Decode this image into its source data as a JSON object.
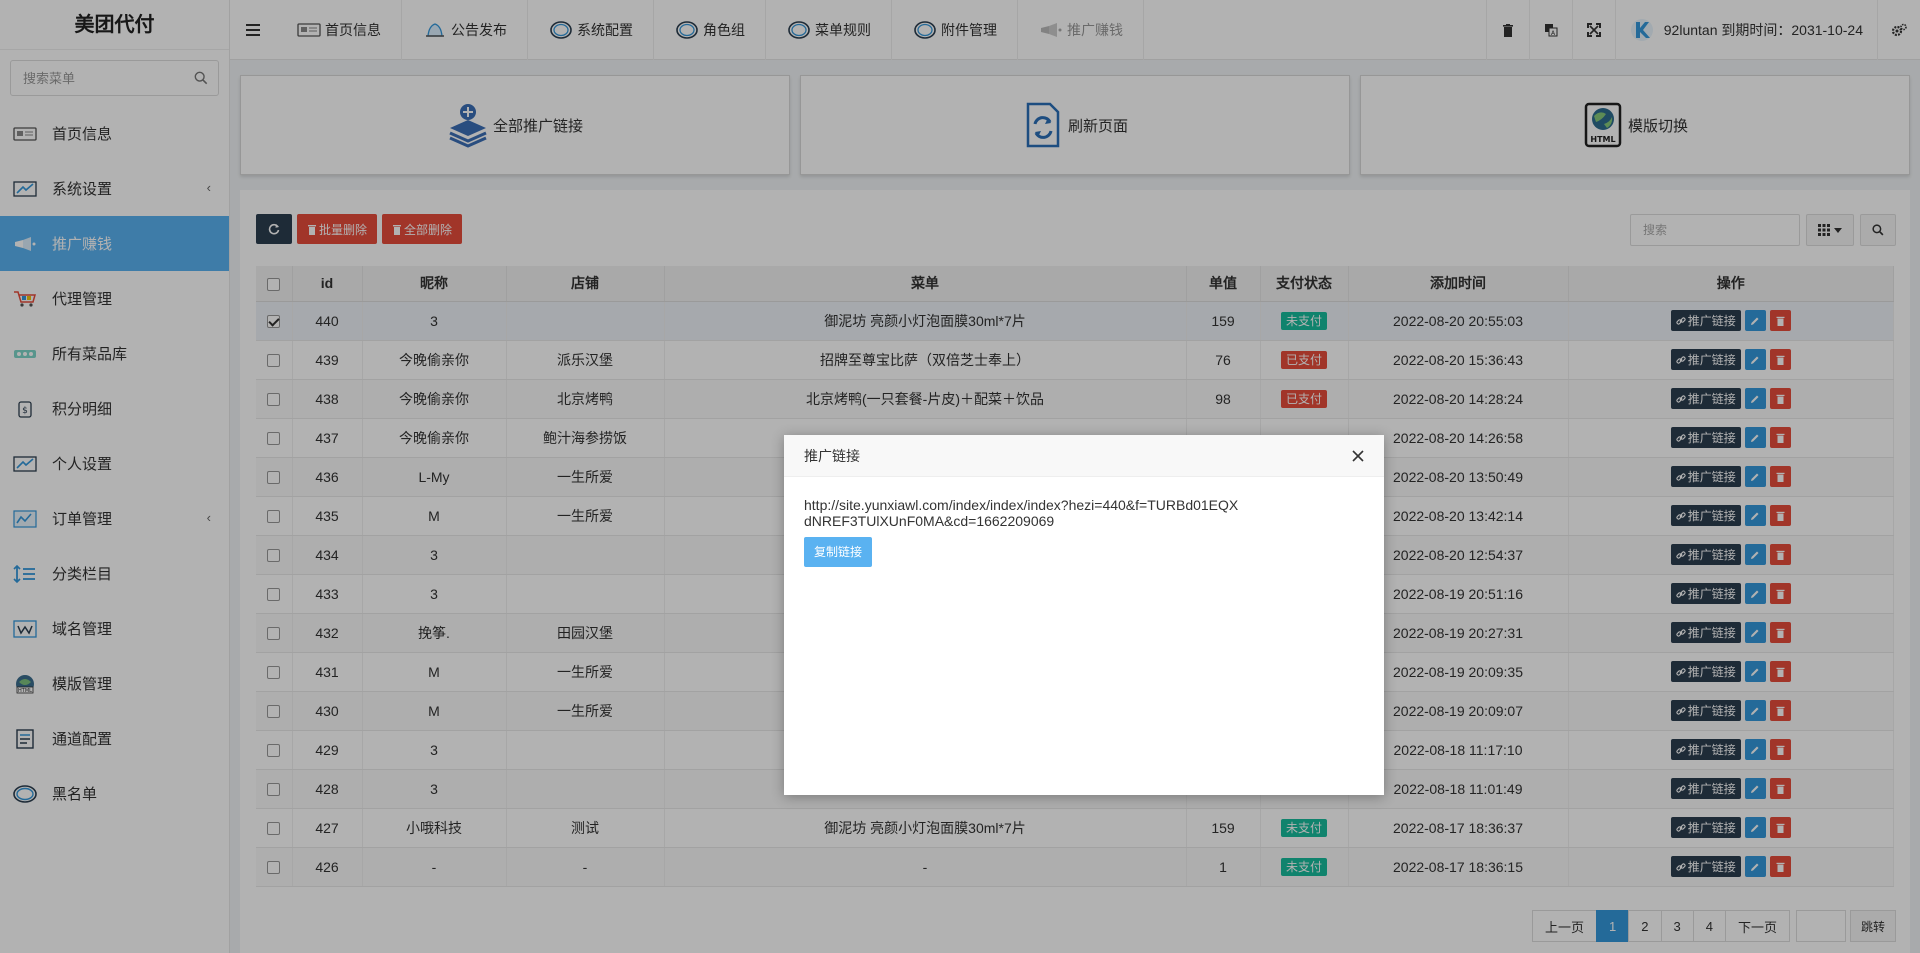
{
  "brand": "美团代付",
  "sidebar": {
    "search_placeholder": "搜索菜单",
    "items": [
      {
        "label": "首页信息",
        "icon": "dashboard-icon"
      },
      {
        "label": "系统设置",
        "icon": "settings-icon",
        "arrow": "‹"
      },
      {
        "label": "推广赚钱",
        "icon": "promote-icon"
      },
      {
        "label": "代理管理",
        "icon": "cart-icon"
      },
      {
        "label": "所有菜品库",
        "icon": "dishes-icon"
      },
      {
        "label": "积分明细",
        "icon": "points-icon"
      },
      {
        "label": "个人设置",
        "icon": "profile-icon"
      },
      {
        "label": "订单管理",
        "icon": "orders-icon",
        "arrow": "‹"
      },
      {
        "label": "分类栏目",
        "icon": "category-icon"
      },
      {
        "label": "域名管理",
        "icon": "domain-icon"
      },
      {
        "label": "模版管理",
        "icon": "template-icon"
      },
      {
        "label": "通道配置",
        "icon": "channel-icon"
      },
      {
        "label": "黑名单",
        "icon": "blacklist-icon"
      }
    ]
  },
  "topnav": {
    "items": [
      {
        "label": "首页信息",
        "icon": "dashboard-icon"
      },
      {
        "label": "公告发布",
        "icon": "bell-icon"
      },
      {
        "label": "系统配置",
        "icon": "circle-icon"
      },
      {
        "label": "角色组",
        "icon": "circle-icon"
      },
      {
        "label": "菜单规则",
        "icon": "circle-icon"
      },
      {
        "label": "附件管理",
        "icon": "circle-icon"
      },
      {
        "label": "推广赚钱",
        "icon": "promote-icon"
      }
    ],
    "user_text": "92luntan 到期时间：2031-10-24"
  },
  "cards": [
    {
      "label": "全部推广链接",
      "icon": "layers-plus-icon"
    },
    {
      "label": "刷新页面",
      "icon": "refresh-doc-icon"
    },
    {
      "label": "模版切换",
      "icon": "html-globe-icon"
    }
  ],
  "toolbar": {
    "batch_delete": "批量删除",
    "delete_all": "全部删除",
    "search_placeholder": "搜索"
  },
  "table": {
    "headers": [
      "id",
      "昵称",
      "店铺",
      "菜单",
      "单值",
      "支付状态",
      "添加时间",
      "操作"
    ],
    "op_link_label": "推广链接",
    "rows": [
      {
        "id": "440",
        "nick": "3",
        "shop": "",
        "menu": "御泥坊 亮颜小灯泡面膜30ml*7片",
        "price": "159",
        "status": "未支付",
        "status_color": "green",
        "time": "2022-08-20 20:55:03",
        "checked": true
      },
      {
        "id": "439",
        "nick": "今晚偷亲你",
        "shop": "派乐汉堡",
        "menu": "招牌至尊宝比萨（双倍芝士奉上）",
        "price": "76",
        "status": "已支付",
        "status_color": "red",
        "time": "2022-08-20 15:36:43"
      },
      {
        "id": "438",
        "nick": "今晚偷亲你",
        "shop": "北京烤鸭",
        "menu": "北京烤鸭(一只套餐-片皮)＋配菜＋饮品",
        "price": "98",
        "status": "已支付",
        "status_color": "red",
        "time": "2022-08-20 14:28:24"
      },
      {
        "id": "437",
        "nick": "今晚偷亲你",
        "shop": "鲍汁海参捞饭",
        "menu": "",
        "price": "",
        "status": "",
        "status_color": "green",
        "time": "2022-08-20 14:26:58"
      },
      {
        "id": "436",
        "nick": "L-My",
        "shop": "一生所爱",
        "menu": "",
        "price": "",
        "status": "",
        "status_color": "green",
        "time": "2022-08-20 13:50:49"
      },
      {
        "id": "435",
        "nick": "M",
        "shop": "一生所爱",
        "menu": "",
        "price": "",
        "status": "",
        "status_color": "green",
        "time": "2022-08-20 13:42:14"
      },
      {
        "id": "434",
        "nick": "3",
        "shop": "",
        "menu": "",
        "price": "",
        "status": "",
        "status_color": "green",
        "time": "2022-08-20 12:54:37"
      },
      {
        "id": "433",
        "nick": "3",
        "shop": "",
        "menu": "",
        "price": "",
        "status": "",
        "status_color": "green",
        "time": "2022-08-19 20:51:16"
      },
      {
        "id": "432",
        "nick": "挽筝.",
        "shop": "田园汉堡",
        "menu": "",
        "price": "",
        "status": "",
        "status_color": "green",
        "time": "2022-08-19 20:27:31"
      },
      {
        "id": "431",
        "nick": "M",
        "shop": "一生所爱",
        "menu": "",
        "price": "",
        "status": "",
        "status_color": "green",
        "time": "2022-08-19 20:09:35"
      },
      {
        "id": "430",
        "nick": "M",
        "shop": "一生所爱",
        "menu": "",
        "price": "",
        "status": "",
        "status_color": "green",
        "time": "2022-08-19 20:09:07"
      },
      {
        "id": "429",
        "nick": "3",
        "shop": "",
        "menu": "",
        "price": "",
        "status": "",
        "status_color": "green",
        "time": "2022-08-18 11:17:10"
      },
      {
        "id": "428",
        "nick": "3",
        "shop": "",
        "menu": "",
        "price": "",
        "status": "",
        "status_color": "green",
        "time": "2022-08-18 11:01:49"
      },
      {
        "id": "427",
        "nick": "小哦科技",
        "shop": "测试",
        "menu": "御泥坊 亮颜小灯泡面膜30ml*7片",
        "price": "159",
        "status": "未支付",
        "status_color": "green",
        "time": "2022-08-17 18:36:37"
      },
      {
        "id": "426",
        "nick": "-",
        "shop": "-",
        "menu": "-",
        "price": "1",
        "status": "未支付",
        "status_color": "green",
        "time": "2022-08-17 18:36:15"
      }
    ]
  },
  "pagination": {
    "prev": "上一页",
    "pages": [
      "1",
      "2",
      "3",
      "4"
    ],
    "current": "1",
    "next": "下一页",
    "jump": "跳转"
  },
  "modal": {
    "title": "推广链接",
    "url": "http://site.yunxiawl.com/index/index/index?hezi=440&f=TURBd01EQXdNREF3TUlXUnF0MA&cd=1662209069",
    "copy_label": "复制链接"
  },
  "colors": {
    "accent": "#5ab2f1",
    "dark_button": "#2c3e50",
    "danger": "#e74c3c",
    "success": "#18bc9c",
    "info": "#3498db"
  }
}
